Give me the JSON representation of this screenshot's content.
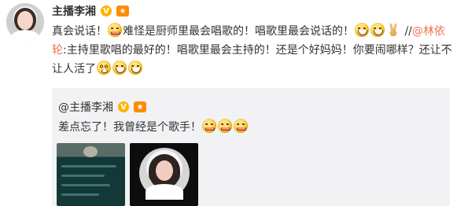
{
  "post": {
    "author": "主播李湘",
    "verified_badge": "V",
    "segments": {
      "s1": "真会说话！",
      "s2": "难怪是厨师里最会唱歌的！唱歌里最会说话的！",
      "s3": " //",
      "mention": "@林依轮",
      "s4": ":主持里歌唱的最好的！唱歌里最会主持的！还是个好妈妈！你要闹哪样？还让不让人活了"
    }
  },
  "repost": {
    "author": "@主播李湘",
    "verified_badge": "V",
    "text": "差点忘了！我曾经是个歌手！"
  },
  "icons": {
    "avatar": "profile-avatar",
    "medal": "medal-icon",
    "emoji_smug": "smug-face-emoji",
    "emoji_grin": "grinning-face-emoji",
    "emoji_dizzy": "dizzy-face-emoji",
    "emoji_v": "victory-hand-emoji"
  },
  "colors": {
    "mention": "#eb7350",
    "badge_v": "#ffb400",
    "repost_bg": "#f2f2f5"
  }
}
